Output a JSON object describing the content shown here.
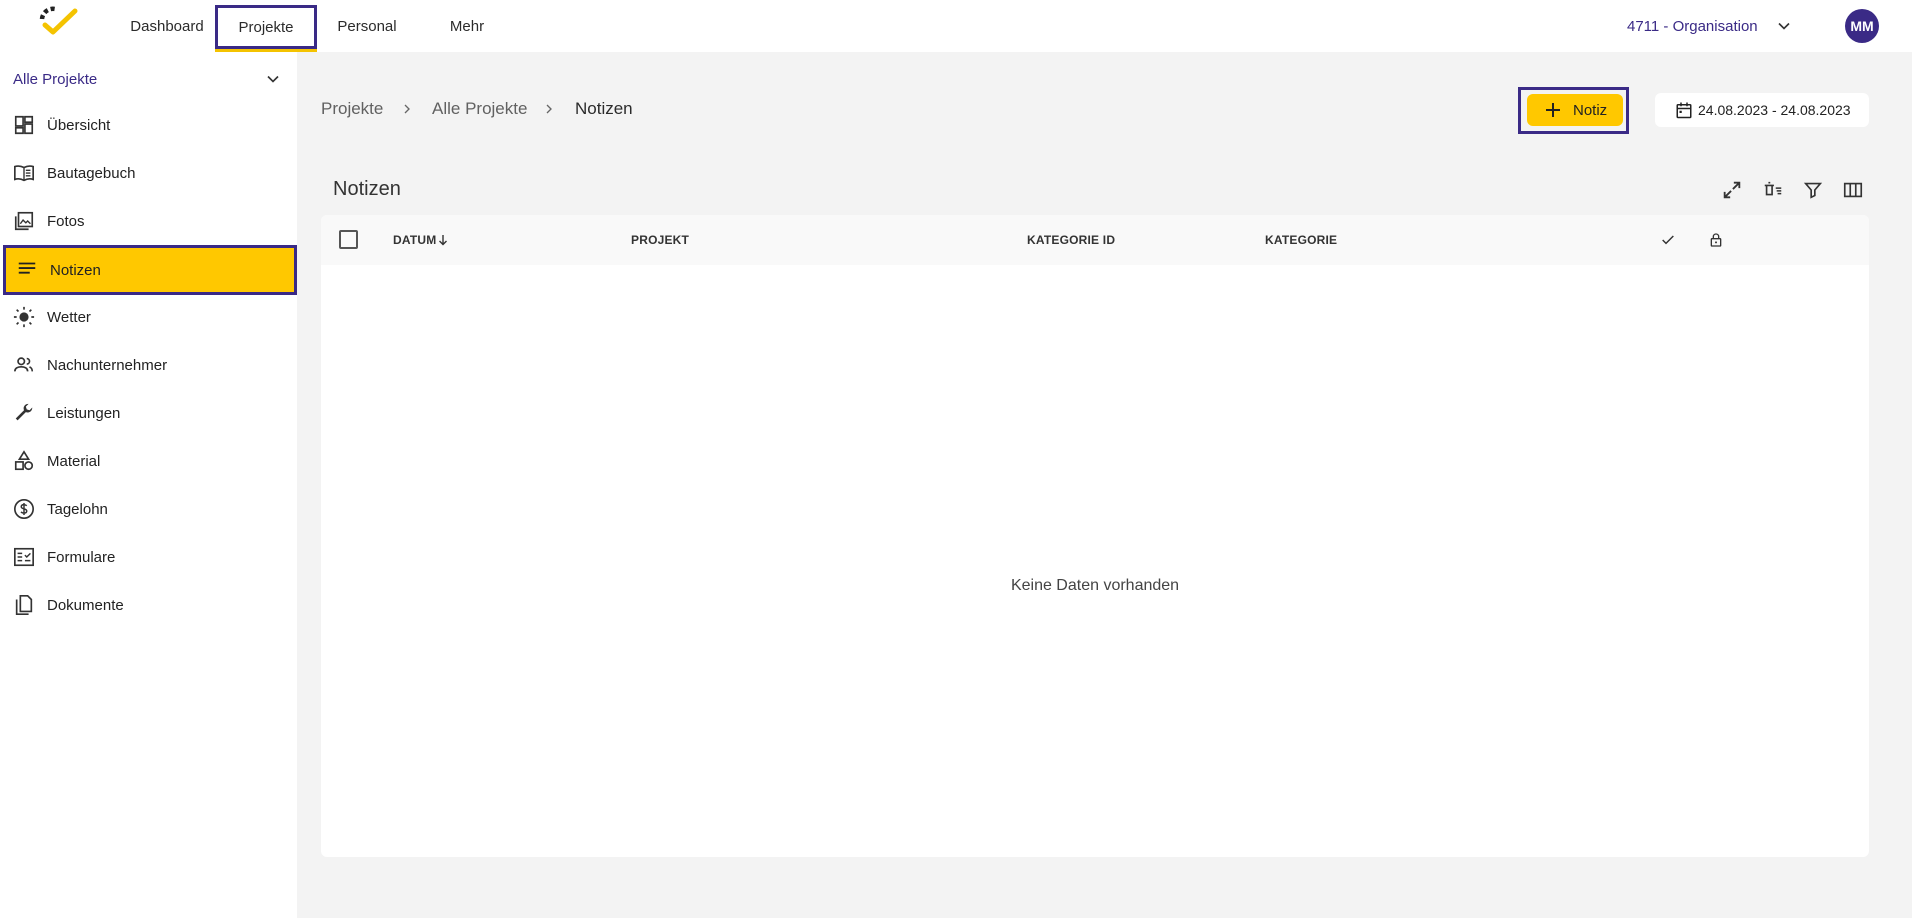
{
  "colors": {
    "brand_purple": "#3a2a86",
    "accent_yellow": "#ffc800"
  },
  "topbar": {
    "nav": [
      {
        "label": "Dashboard"
      },
      {
        "label": "Projekte"
      },
      {
        "label": "Personal"
      },
      {
        "label": "Mehr"
      }
    ],
    "active_nav": "Projekte",
    "organization": "4711 - Organisation",
    "avatar_initials": "MM"
  },
  "sidebar": {
    "project_select": "Alle Projekte",
    "items": [
      {
        "label": "Übersicht",
        "icon": "dashboard-icon"
      },
      {
        "label": "Bautagebuch",
        "icon": "book-icon"
      },
      {
        "label": "Fotos",
        "icon": "photos-icon"
      },
      {
        "label": "Notizen",
        "icon": "notes-icon"
      },
      {
        "label": "Wetter",
        "icon": "sun-icon"
      },
      {
        "label": "Nachunternehmer",
        "icon": "people-icon"
      },
      {
        "label": "Leistungen",
        "icon": "wrench-icon"
      },
      {
        "label": "Material",
        "icon": "shapes-icon"
      },
      {
        "label": "Tagelohn",
        "icon": "dollar-icon"
      },
      {
        "label": "Formulare",
        "icon": "form-icon"
      },
      {
        "label": "Dokumente",
        "icon": "documents-icon"
      }
    ],
    "active_item": "Notizen"
  },
  "breadcrumb": [
    "Projekte",
    "Alle Projekte",
    "Notizen"
  ],
  "actions": {
    "add_label": "Notiz",
    "date_range": "24.08.2023 - 24.08.2023"
  },
  "table": {
    "title": "Notizen",
    "columns": {
      "datum": "DATUM",
      "projekt": "PROJEKT",
      "kategorie_id": "KATEGORIE ID",
      "kategorie": "KATEGORIE"
    },
    "sort": {
      "column": "DATUM",
      "direction": "desc"
    },
    "empty_text": "Keine Daten vorhanden"
  }
}
